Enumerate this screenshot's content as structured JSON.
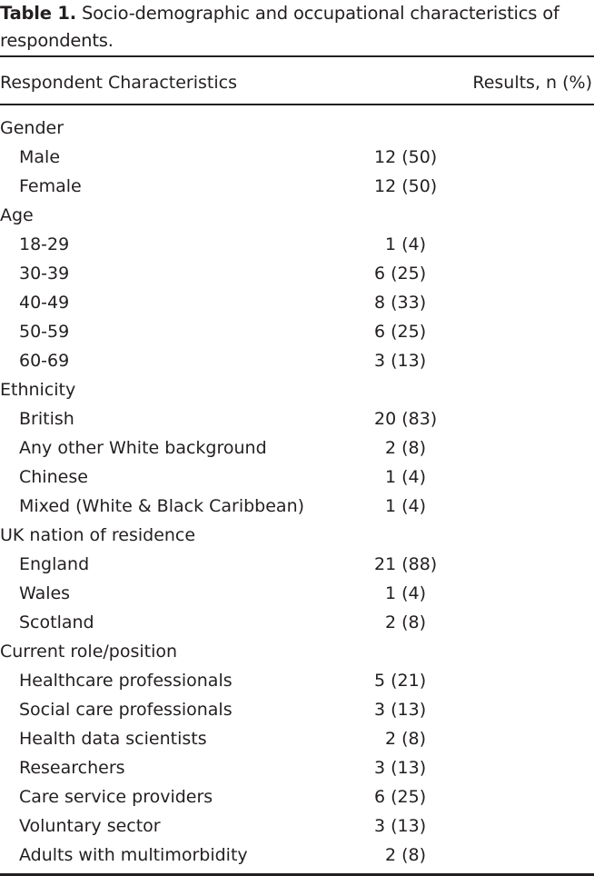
{
  "caption": {
    "label": "Table 1.",
    "text": " Socio-demographic and occupational characteristics of respondents."
  },
  "header": {
    "col1": "Respondent Characteristics",
    "col2": "Results, n (%)"
  },
  "rows": [
    {
      "label": "Gender",
      "value": "",
      "type": "group"
    },
    {
      "label": "Male",
      "value": "12 (50)",
      "type": "sub"
    },
    {
      "label": "Female",
      "value": "12 (50)",
      "type": "sub"
    },
    {
      "label": "Age",
      "value": "",
      "type": "group"
    },
    {
      "label": "18-29",
      "value": "1 (4)",
      "type": "sub"
    },
    {
      "label": "30-39",
      "value": "6 (25)",
      "type": "sub"
    },
    {
      "label": "40-49",
      "value": "8 (33)",
      "type": "sub"
    },
    {
      "label": "50-59",
      "value": "6 (25)",
      "type": "sub"
    },
    {
      "label": "60-69",
      "value": "3 (13)",
      "type": "sub"
    },
    {
      "label": "Ethnicity",
      "value": "",
      "type": "group"
    },
    {
      "label": "British",
      "value": "20 (83)",
      "type": "sub"
    },
    {
      "label": "Any other White background",
      "value": "2 (8)",
      "type": "sub"
    },
    {
      "label": "Chinese",
      "value": "1 (4)",
      "type": "sub"
    },
    {
      "label": "Mixed (White & Black Caribbean)",
      "value": "1 (4)",
      "type": "sub"
    },
    {
      "label": "UK nation of residence",
      "value": "",
      "type": "group"
    },
    {
      "label": "England",
      "value": "21 (88)",
      "type": "sub"
    },
    {
      "label": "Wales",
      "value": "1 (4)",
      "type": "sub"
    },
    {
      "label": "Scotland",
      "value": "2 (8)",
      "type": "sub"
    },
    {
      "label": "Current role/position",
      "value": "",
      "type": "group"
    },
    {
      "label": "Healthcare professionals",
      "value": "5 (21)",
      "type": "sub"
    },
    {
      "label": "Social care professionals",
      "value": "3 (13)",
      "type": "sub"
    },
    {
      "label": "Health data scientists",
      "value": "2 (8)",
      "type": "sub"
    },
    {
      "label": "Researchers",
      "value": "3 (13)",
      "type": "sub"
    },
    {
      "label": "Care service providers",
      "value": "6 (25)",
      "type": "sub"
    },
    {
      "label": "Voluntary sector",
      "value": "3 (13)",
      "type": "sub"
    },
    {
      "label": "Adults with multimorbidity",
      "value": "2 (8)",
      "type": "sub"
    }
  ]
}
